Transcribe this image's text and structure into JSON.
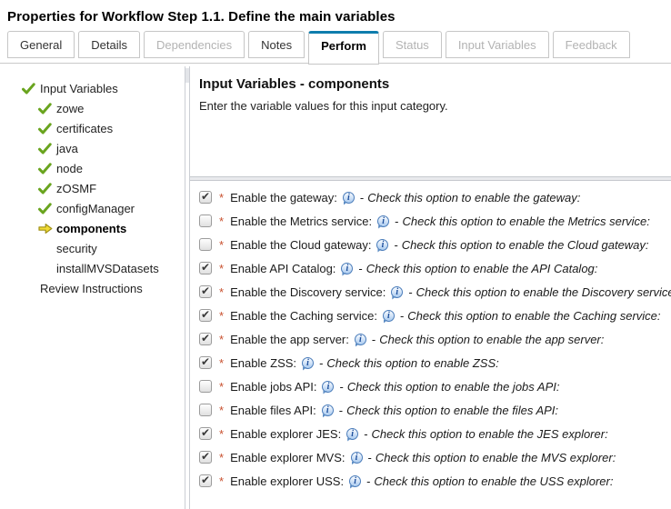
{
  "window": {
    "title": "Properties for Workflow Step 1.1. Define the main variables"
  },
  "tabs": [
    {
      "label": "General",
      "state": "normal"
    },
    {
      "label": "Details",
      "state": "normal"
    },
    {
      "label": "Dependencies",
      "state": "disabled"
    },
    {
      "label": "Notes",
      "state": "normal"
    },
    {
      "label": "Perform",
      "state": "active"
    },
    {
      "label": "Status",
      "state": "disabled"
    },
    {
      "label": "Input Variables",
      "state": "disabled"
    },
    {
      "label": "Feedback",
      "state": "disabled"
    }
  ],
  "tree": {
    "items": [
      {
        "label": "Input Variables",
        "level": 0,
        "status": "complete",
        "bold": false
      },
      {
        "label": "zowe",
        "level": 1,
        "status": "complete",
        "bold": false
      },
      {
        "label": "certificates",
        "level": 1,
        "status": "complete",
        "bold": false
      },
      {
        "label": "java",
        "level": 1,
        "status": "complete",
        "bold": false
      },
      {
        "label": "node",
        "level": 1,
        "status": "complete",
        "bold": false
      },
      {
        "label": "zOSMF",
        "level": 1,
        "status": "complete",
        "bold": false
      },
      {
        "label": "configManager",
        "level": 1,
        "status": "complete",
        "bold": false
      },
      {
        "label": "components",
        "level": 1,
        "status": "current",
        "bold": true
      },
      {
        "label": "security",
        "level": 1,
        "status": "none",
        "bold": false
      },
      {
        "label": "installMVSDatasets",
        "level": 1,
        "status": "none",
        "bold": false
      },
      {
        "label": "Review Instructions",
        "level": 0,
        "status": "none",
        "bold": false
      }
    ]
  },
  "main": {
    "heading": "Input Variables - components",
    "instruction": "Enter the variable values for this input category."
  },
  "form": {
    "required_marker": "*",
    "separator": "-",
    "info_glyph": "i",
    "rows": [
      {
        "checked": true,
        "label": "Enable the gateway:",
        "description": "Check this option to enable the gateway:"
      },
      {
        "checked": false,
        "label": "Enable the Metrics service:",
        "description": "Check this option to enable the Metrics service:"
      },
      {
        "checked": false,
        "label": "Enable the Cloud gateway:",
        "description": "Check this option to enable the Cloud gateway:"
      },
      {
        "checked": true,
        "label": "Enable API Catalog:",
        "description": "Check this option to enable the API Catalog:"
      },
      {
        "checked": true,
        "label": "Enable the Discovery service:",
        "description": "Check this option to enable the Discovery service:"
      },
      {
        "checked": true,
        "label": "Enable the Caching service:",
        "description": "Check this option to enable the Caching service:"
      },
      {
        "checked": true,
        "label": "Enable the app server:",
        "description": "Check this option to enable the app server:"
      },
      {
        "checked": true,
        "label": "Enable ZSS:",
        "description": "Check this option to enable ZSS:"
      },
      {
        "checked": false,
        "label": "Enable jobs API:",
        "description": "Check this option to enable the jobs API:"
      },
      {
        "checked": false,
        "label": "Enable files API:",
        "description": "Check this option to enable the files API:"
      },
      {
        "checked": true,
        "label": "Enable explorer JES:",
        "description": "Check this option to enable the JES explorer:"
      },
      {
        "checked": true,
        "label": "Enable explorer MVS:",
        "description": "Check this option to enable the MVS explorer:"
      },
      {
        "checked": true,
        "label": "Enable explorer USS:",
        "description": "Check this option to enable the USS explorer:"
      }
    ]
  },
  "colors": {
    "active_tab_accent": "#0e7dad",
    "check_green": "#69a41e",
    "arrow_yellow": "#f1db33",
    "required_red": "#c8502e",
    "info_blue": "#4a7cba",
    "splitter_gray": "#e9eaed"
  }
}
